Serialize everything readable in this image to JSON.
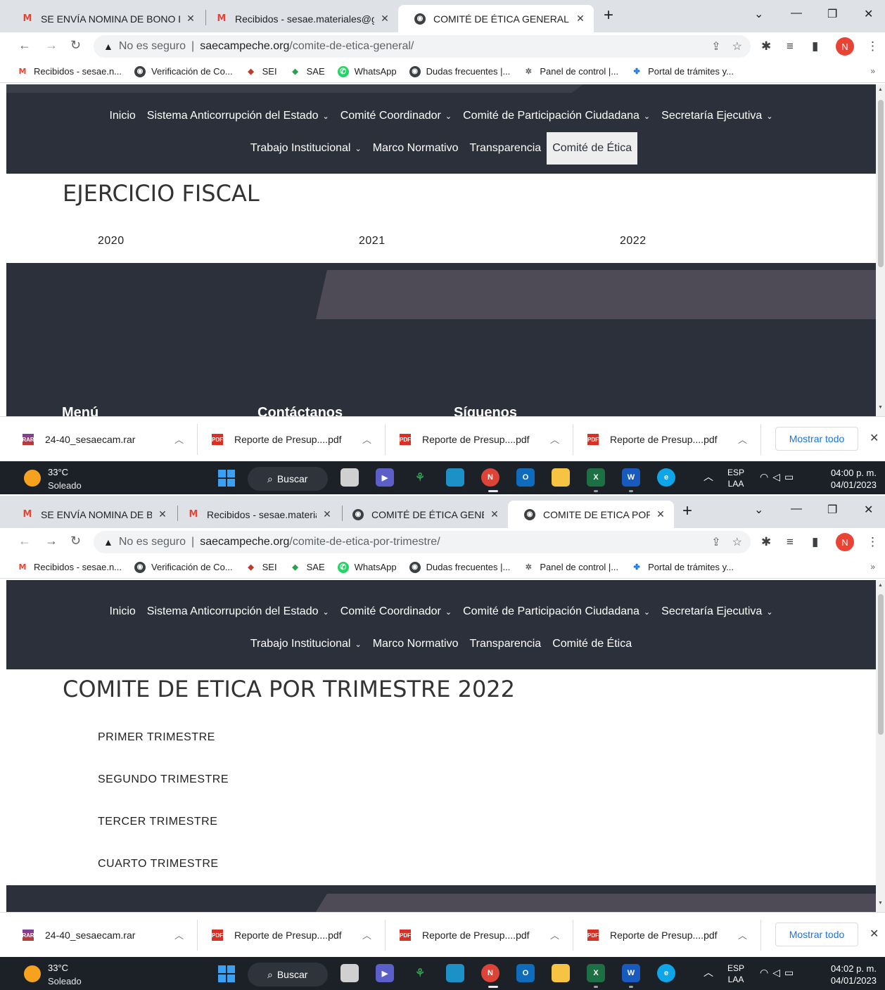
{
  "shots": [
    {
      "tabs": [
        {
          "title": "SE ENVÍA NOMINA DE BONO DE",
          "icon": "gmail-icon"
        },
        {
          "title": "Recibidos - sesae.materiales@gm",
          "icon": "gmail-icon"
        },
        {
          "title": "COMITÉ DE ÉTICA GENERAL",
          "icon": "globe-icon"
        }
      ],
      "url": {
        "insecure_label": "No es seguro",
        "host": "saecampeche.org",
        "path": "/comite-de-etica-general/"
      },
      "page": {
        "title": "EJERCICIO FISCAL",
        "years": [
          "2020",
          "2021",
          "2022"
        ],
        "footer": {
          "menu": "Menú",
          "contact": "Contáctanos",
          "follow": "Síguenos"
        }
      },
      "clock": {
        "time": "04:00 p. m.",
        "date": "04/01/2023"
      }
    },
    {
      "tabs": [
        {
          "title": "SE ENVÍA NOMINA DE BO",
          "icon": "gmail-icon"
        },
        {
          "title": "Recibidos - sesae.materiale",
          "icon": "gmail-icon"
        },
        {
          "title": "COMITÉ DE ÉTICA GENERA",
          "icon": "globe-icon"
        },
        {
          "title": "COMITE DE ETICA POR TR",
          "icon": "globe-icon"
        }
      ],
      "url": {
        "insecure_label": "No es seguro",
        "host": "saecampeche.org",
        "path": "/comite-de-etica-por-trimestre/"
      },
      "page": {
        "title": "COMITE DE ETICA POR TRIMESTRE 2022",
        "quarters": [
          "PRIMER TRIMESTRE",
          "SEGUNDO TRIMESTRE",
          "TERCER TRIMESTRE",
          "CUARTO TRIMESTRE"
        ]
      },
      "clock": {
        "time": "04:02 p. m.",
        "date": "04/01/2023"
      }
    }
  ],
  "bookmarks": [
    {
      "label": "Recibidos - sesae.n...",
      "icon": "gmail-icon"
    },
    {
      "label": "Verificación de Co...",
      "icon": "globe-icon"
    },
    {
      "label": "SEI",
      "icon": "sei-icon"
    },
    {
      "label": "SAE",
      "icon": "sae-icon"
    },
    {
      "label": "WhatsApp",
      "icon": "whatsapp-icon"
    },
    {
      "label": "Dudas frecuentes |...",
      "icon": "globe-icon"
    },
    {
      "label": "Panel de control |...",
      "icon": "panel-icon"
    },
    {
      "label": "Portal de trámites y...",
      "icon": "portal-icon"
    }
  ],
  "site_nav": {
    "row1": [
      {
        "label": "Inicio",
        "dropdown": false
      },
      {
        "label": "Sistema Anticorrupción del Estado",
        "dropdown": true
      },
      {
        "label": "Comité Coordinador",
        "dropdown": true
      },
      {
        "label": "Comité de Participación Ciudadana",
        "dropdown": true
      },
      {
        "label": "Secretaría Ejecutiva",
        "dropdown": true
      }
    ],
    "row2": [
      {
        "label": "Trabajo Institucional",
        "dropdown": true
      },
      {
        "label": "Marco Normativo",
        "dropdown": false
      },
      {
        "label": "Transparencia",
        "dropdown": false
      },
      {
        "label": "Comité de Ética",
        "dropdown": false
      }
    ]
  },
  "downloads": [
    {
      "name": "24-40_sesaecam.rar",
      "type": "rar"
    },
    {
      "name": "Reporte de Presup....pdf",
      "type": "pdf"
    },
    {
      "name": "Reporte de Presup....pdf",
      "type": "pdf"
    },
    {
      "name": "Reporte de Presup....pdf",
      "type": "pdf"
    }
  ],
  "downloads_show_all": "Mostrar todo",
  "weather": {
    "temp": "33°C",
    "desc": "Soleado"
  },
  "taskbar_search": "Buscar",
  "tray_lang": {
    "line1": "ESP",
    "line2": "LAA"
  },
  "profile_initial": "N",
  "colors": {
    "site_nav_bg": "#2b303a",
    "footer_slant": "#4e4a56",
    "accent_link": "#1a73e8"
  }
}
